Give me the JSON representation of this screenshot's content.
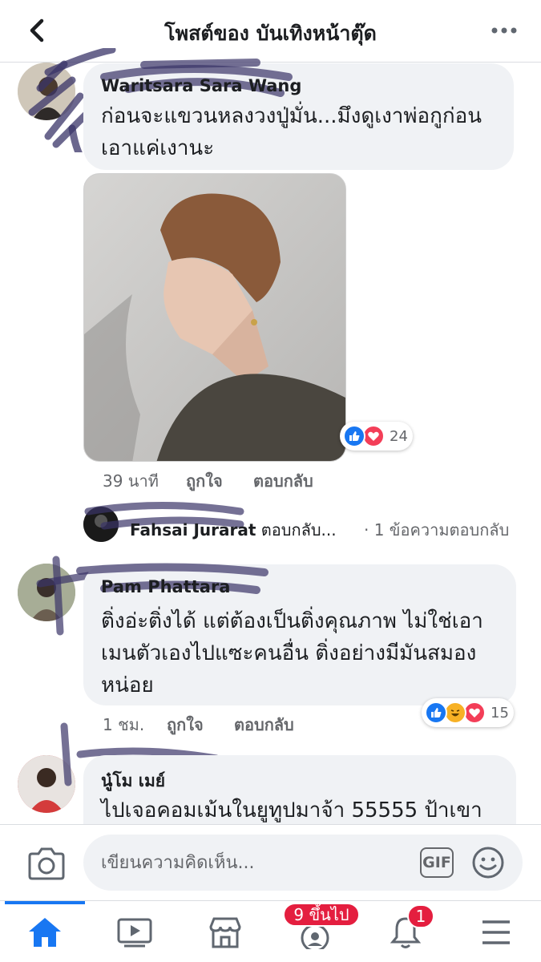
{
  "header": {
    "title": "โพสต์ของ บันเทิงหน้าตุ๊ด",
    "back_icon": "chevron-left-icon",
    "more_icon": "ellipsis-icon"
  },
  "comments": [
    {
      "author": "Waritsara Sara Wang",
      "lines": [
        "ก่อนจะแขวนหลงวงปู่มั่น...มึงดูเงาพ่อกูก่อน",
        "เอาแค่เงานะ"
      ],
      "time": "39 นาที",
      "like_label": "ถูกใจ",
      "reply_label": "ตอบกลับ",
      "reactions": [
        "like",
        "love"
      ],
      "reaction_count": "24"
    },
    {
      "author": "Pam Phattara",
      "lines": [
        "ติ่งอ่ะติ่งได้ แต่ต้องเป็นติ่งคุณภาพ ไม่ใช่เอา",
        "เมนตัวเองไปแซะคนอื่น ติ่งอย่างมีมันสมอง",
        "หน่อย"
      ],
      "time": "1 ชม.",
      "like_label": "ถูกใจ",
      "reply_label": "ตอบกลับ",
      "reactions": [
        "like",
        "haha",
        "love"
      ],
      "reaction_count": "15"
    },
    {
      "author": "นู๋โม เมย์",
      "lines": [
        "ไปเจอคอมเม้นในยูทูปมาจ้า 55555 ป้าเขา"
      ]
    }
  ],
  "reply_preview": {
    "author": "Fahsai Jurarat",
    "action": "ตอบกลับ...",
    "count_text": "· 1 ข้อความตอบกลับ"
  },
  "composer": {
    "placeholder": "เขียนความคิดเห็น...",
    "gif_label": "GIF",
    "camera_icon": "camera-icon",
    "emoji_icon": "smiley-icon"
  },
  "tabbar": {
    "tabs": [
      "home-icon",
      "video-icon",
      "marketplace-icon",
      "groups-icon",
      "bell-icon",
      "menu-icon"
    ],
    "groups_badge": "9 ขึ้นไป",
    "notifications_badge": "1"
  },
  "colors": {
    "accent": "#1877f2",
    "like": "#1877f2",
    "love": "#f33e58",
    "haha": "#f7b125",
    "badge": "#e41e3f",
    "bubble": "#f0f2f5",
    "scribble": "#3a3468"
  }
}
